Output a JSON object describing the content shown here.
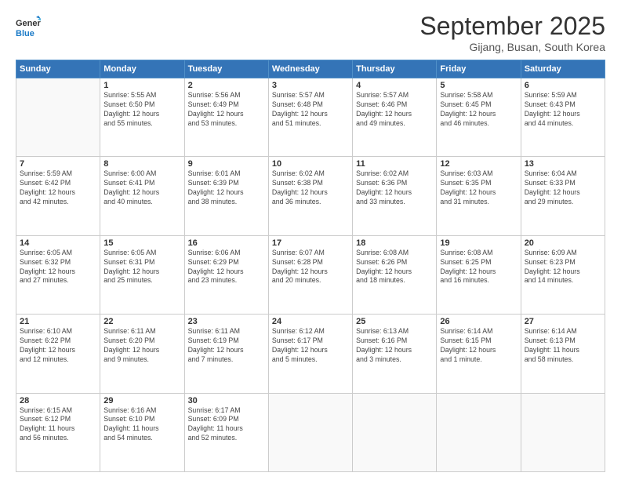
{
  "header": {
    "logo_line1": "General",
    "logo_line2": "Blue",
    "month": "September 2025",
    "location": "Gijang, Busan, South Korea"
  },
  "weekdays": [
    "Sunday",
    "Monday",
    "Tuesday",
    "Wednesday",
    "Thursday",
    "Friday",
    "Saturday"
  ],
  "weeks": [
    [
      {
        "day": "",
        "info": ""
      },
      {
        "day": "1",
        "info": "Sunrise: 5:55 AM\nSunset: 6:50 PM\nDaylight: 12 hours\nand 55 minutes."
      },
      {
        "day": "2",
        "info": "Sunrise: 5:56 AM\nSunset: 6:49 PM\nDaylight: 12 hours\nand 53 minutes."
      },
      {
        "day": "3",
        "info": "Sunrise: 5:57 AM\nSunset: 6:48 PM\nDaylight: 12 hours\nand 51 minutes."
      },
      {
        "day": "4",
        "info": "Sunrise: 5:57 AM\nSunset: 6:46 PM\nDaylight: 12 hours\nand 49 minutes."
      },
      {
        "day": "5",
        "info": "Sunrise: 5:58 AM\nSunset: 6:45 PM\nDaylight: 12 hours\nand 46 minutes."
      },
      {
        "day": "6",
        "info": "Sunrise: 5:59 AM\nSunset: 6:43 PM\nDaylight: 12 hours\nand 44 minutes."
      }
    ],
    [
      {
        "day": "7",
        "info": "Sunrise: 5:59 AM\nSunset: 6:42 PM\nDaylight: 12 hours\nand 42 minutes."
      },
      {
        "day": "8",
        "info": "Sunrise: 6:00 AM\nSunset: 6:41 PM\nDaylight: 12 hours\nand 40 minutes."
      },
      {
        "day": "9",
        "info": "Sunrise: 6:01 AM\nSunset: 6:39 PM\nDaylight: 12 hours\nand 38 minutes."
      },
      {
        "day": "10",
        "info": "Sunrise: 6:02 AM\nSunset: 6:38 PM\nDaylight: 12 hours\nand 36 minutes."
      },
      {
        "day": "11",
        "info": "Sunrise: 6:02 AM\nSunset: 6:36 PM\nDaylight: 12 hours\nand 33 minutes."
      },
      {
        "day": "12",
        "info": "Sunrise: 6:03 AM\nSunset: 6:35 PM\nDaylight: 12 hours\nand 31 minutes."
      },
      {
        "day": "13",
        "info": "Sunrise: 6:04 AM\nSunset: 6:33 PM\nDaylight: 12 hours\nand 29 minutes."
      }
    ],
    [
      {
        "day": "14",
        "info": "Sunrise: 6:05 AM\nSunset: 6:32 PM\nDaylight: 12 hours\nand 27 minutes."
      },
      {
        "day": "15",
        "info": "Sunrise: 6:05 AM\nSunset: 6:31 PM\nDaylight: 12 hours\nand 25 minutes."
      },
      {
        "day": "16",
        "info": "Sunrise: 6:06 AM\nSunset: 6:29 PM\nDaylight: 12 hours\nand 23 minutes."
      },
      {
        "day": "17",
        "info": "Sunrise: 6:07 AM\nSunset: 6:28 PM\nDaylight: 12 hours\nand 20 minutes."
      },
      {
        "day": "18",
        "info": "Sunrise: 6:08 AM\nSunset: 6:26 PM\nDaylight: 12 hours\nand 18 minutes."
      },
      {
        "day": "19",
        "info": "Sunrise: 6:08 AM\nSunset: 6:25 PM\nDaylight: 12 hours\nand 16 minutes."
      },
      {
        "day": "20",
        "info": "Sunrise: 6:09 AM\nSunset: 6:23 PM\nDaylight: 12 hours\nand 14 minutes."
      }
    ],
    [
      {
        "day": "21",
        "info": "Sunrise: 6:10 AM\nSunset: 6:22 PM\nDaylight: 12 hours\nand 12 minutes."
      },
      {
        "day": "22",
        "info": "Sunrise: 6:11 AM\nSunset: 6:20 PM\nDaylight: 12 hours\nand 9 minutes."
      },
      {
        "day": "23",
        "info": "Sunrise: 6:11 AM\nSunset: 6:19 PM\nDaylight: 12 hours\nand 7 minutes."
      },
      {
        "day": "24",
        "info": "Sunrise: 6:12 AM\nSunset: 6:17 PM\nDaylight: 12 hours\nand 5 minutes."
      },
      {
        "day": "25",
        "info": "Sunrise: 6:13 AM\nSunset: 6:16 PM\nDaylight: 12 hours\nand 3 minutes."
      },
      {
        "day": "26",
        "info": "Sunrise: 6:14 AM\nSunset: 6:15 PM\nDaylight: 12 hours\nand 1 minute."
      },
      {
        "day": "27",
        "info": "Sunrise: 6:14 AM\nSunset: 6:13 PM\nDaylight: 11 hours\nand 58 minutes."
      }
    ],
    [
      {
        "day": "28",
        "info": "Sunrise: 6:15 AM\nSunset: 6:12 PM\nDaylight: 11 hours\nand 56 minutes."
      },
      {
        "day": "29",
        "info": "Sunrise: 6:16 AM\nSunset: 6:10 PM\nDaylight: 11 hours\nand 54 minutes."
      },
      {
        "day": "30",
        "info": "Sunrise: 6:17 AM\nSunset: 6:09 PM\nDaylight: 11 hours\nand 52 minutes."
      },
      {
        "day": "",
        "info": ""
      },
      {
        "day": "",
        "info": ""
      },
      {
        "day": "",
        "info": ""
      },
      {
        "day": "",
        "info": ""
      }
    ]
  ]
}
